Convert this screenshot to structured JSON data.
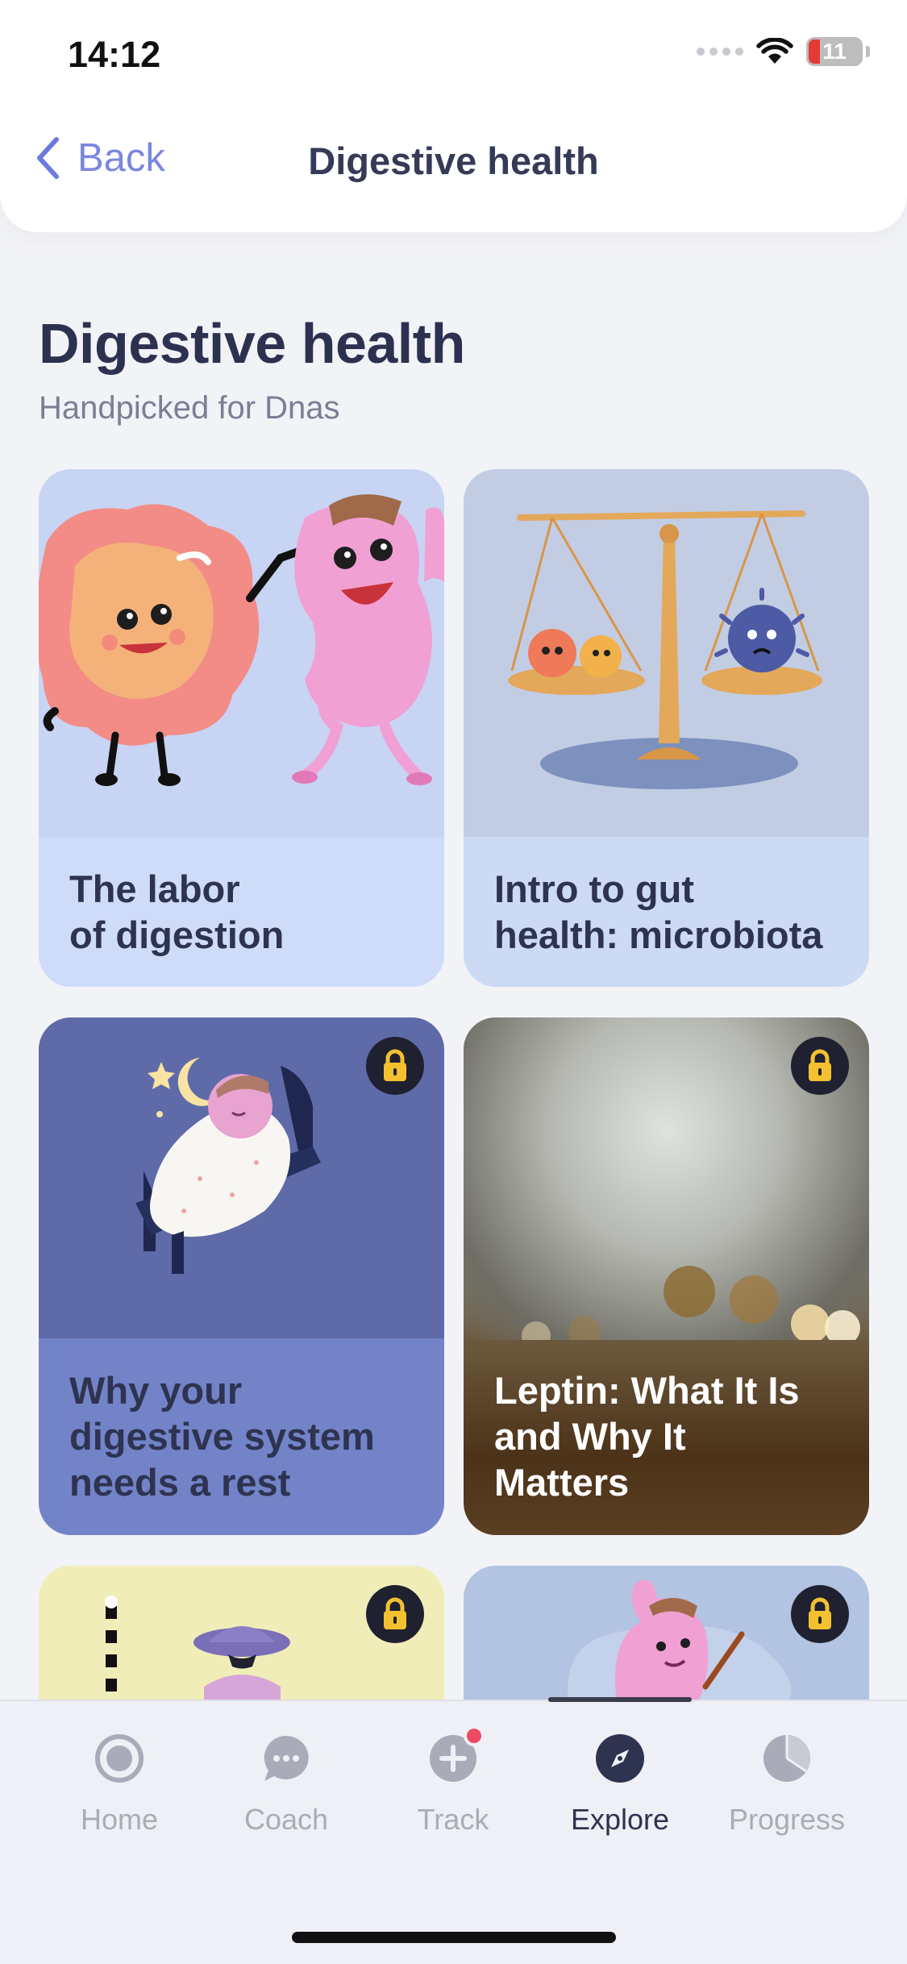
{
  "status_bar": {
    "time": "14:12",
    "battery": "11"
  },
  "nav": {
    "back_label": "Back",
    "title": "Digestive health"
  },
  "header": {
    "title": "Digestive health",
    "subtitle": "Handpicked for Dnas"
  },
  "cards": [
    {
      "title_line1": "The labor",
      "title_line2": "of digestion",
      "locked": false,
      "color": "#c9d6f8"
    },
    {
      "title_line1": "Intro to gut",
      "title_line2": "health: microbiota",
      "locked": false,
      "color": "#c6d4ee"
    },
    {
      "title_line1": "Why your",
      "title_line2": "digestive system",
      "title_line3": "needs a rest",
      "locked": true,
      "color": "#7283c8"
    },
    {
      "title_line1": "Leptin: What It Is",
      "title_line2": "and Why It",
      "title_line3": "Matters",
      "locked": true,
      "color": "#5a3f22"
    },
    {
      "locked": true,
      "color": "#f0edb8"
    },
    {
      "locked": true,
      "color": "#b3c3e2"
    }
  ],
  "tab_bar": {
    "tabs": [
      {
        "label": "Home",
        "icon": "home-icon",
        "active": false
      },
      {
        "label": "Coach",
        "icon": "chat-bubble-icon",
        "active": false
      },
      {
        "label": "Track",
        "icon": "plus-icon",
        "active": false,
        "notification": true
      },
      {
        "label": "Explore",
        "icon": "compass-icon",
        "active": true
      },
      {
        "label": "Progress",
        "icon": "pie-chart-icon",
        "active": false
      }
    ]
  }
}
